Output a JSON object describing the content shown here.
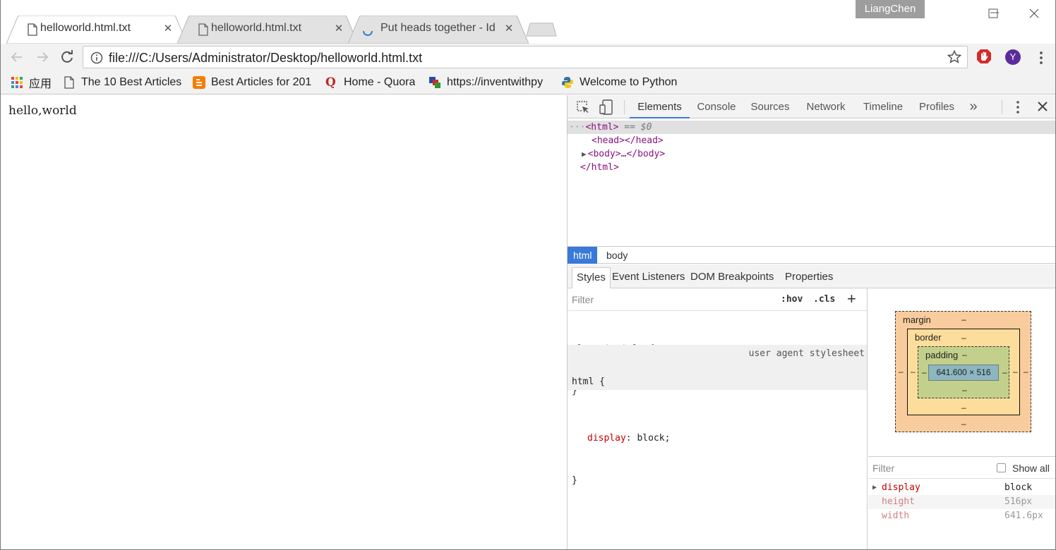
{
  "browser": {
    "profile_name": "LiangChen",
    "tabs": [
      {
        "title": "helloworld.html.txt",
        "active": true
      },
      {
        "title": "helloworld.html.txt",
        "active": false
      },
      {
        "title": "Put heads together - Id",
        "active": false,
        "loading": true
      }
    ],
    "url": "file:///C:/Users/Administrator/Desktop/helloworld.html.txt",
    "extensions": [
      {
        "icon": "adblock-icon",
        "color": "#d42a2a"
      },
      {
        "icon": "profile-y-icon",
        "label": "Y",
        "color": "#5b2b9a"
      }
    ]
  },
  "bookmarks": [
    {
      "label": "应用",
      "icon": "apps-grid-icon"
    },
    {
      "label": "The 10 Best Articles",
      "icon": "page-icon"
    },
    {
      "label": "Best Articles for 201",
      "icon": "blogger-icon"
    },
    {
      "label": "Home - Quora",
      "icon": "quora-icon"
    },
    {
      "label": "https://inventwithpy",
      "icon": "inventwithpython-icon"
    },
    {
      "label": "Welcome to Python",
      "icon": "python-icon"
    }
  ],
  "page": {
    "content": "hello,world"
  },
  "devtools": {
    "tabs": [
      "Elements",
      "Console",
      "Sources",
      "Network",
      "Timeline",
      "Profiles"
    ],
    "active_tab": "Elements",
    "more_label": "»",
    "dom": {
      "html_open": "<html>",
      "selected_marker": "== $0",
      "head": "<head></head>",
      "body": "<body>…</body>",
      "html_close": "</html>"
    },
    "breadcrumbs": [
      "html",
      "body"
    ],
    "subtabs": [
      "Styles",
      "Event Listeners",
      "DOM Breakpoints",
      "Properties"
    ],
    "styles": {
      "filter_placeholder": "Filter",
      "hov_label": ":hov",
      "cls_label": ".cls",
      "add_label": "+",
      "element_style_open": "element.style {",
      "element_style_close": "}",
      "rule_selector": "html {",
      "rule_source": "user agent stylesheet",
      "rule_prop": "display",
      "rule_value": "block;",
      "rule_close": "}"
    },
    "box_model": {
      "margin_label": "margin",
      "border_label": "border",
      "padding_label": "padding",
      "dash": "–",
      "content_size": "641.600 × 516"
    },
    "computed": {
      "filter_placeholder": "Filter",
      "show_all_label": "Show all",
      "rows": [
        {
          "name": "display",
          "value": "block"
        },
        {
          "name": "height",
          "value": "516px"
        },
        {
          "name": "width",
          "value": "641.6px"
        }
      ]
    }
  }
}
